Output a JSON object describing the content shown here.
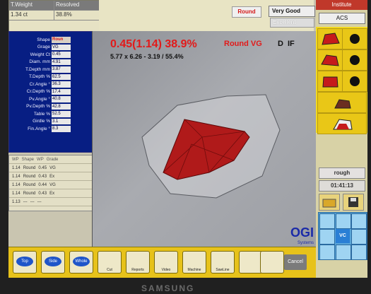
{
  "top_table": {
    "headers": [
      "T.Weight",
      "Resolved"
    ],
    "values": [
      "1.34 ct",
      "38.8%"
    ]
  },
  "params": [
    {
      "label": "Shape",
      "value": "Roun",
      "red": true
    },
    {
      "label": "Grage",
      "value": "VG"
    },
    {
      "label": "Weight  Ct",
      "value": "0.45"
    },
    {
      "label": "Diam.  mm",
      "value": "4.91"
    },
    {
      "label": "T.Depth  mm",
      "value": "3.87"
    },
    {
      "label": "T.Depth  %",
      "value": "62.5"
    },
    {
      "label": "Cr.Angle  °",
      "value": "36.3"
    },
    {
      "label": "Cr.Depth  %",
      "value": "17.4"
    },
    {
      "label": "Pv.Angle  °",
      "value": "40.8"
    },
    {
      "label": "Pv.Depth  %",
      "value": "42.8"
    },
    {
      "label": "Table  %",
      "value": "52.5"
    },
    {
      "label": "Girdle  %",
      "value": "3.1"
    },
    {
      "label": "Fin.Angle  °",
      "value": "8.3"
    }
  ],
  "history": {
    "headers": [
      "WP",
      "Shape",
      "WP",
      "Grade"
    ],
    "rows": [
      [
        "1.14",
        "Round",
        "0.45",
        "VG"
      ],
      [
        "1.14",
        "Round",
        "0.43",
        "Ex"
      ],
      [
        "1.14",
        "Round",
        "0.44",
        "VG"
      ],
      [
        "1.14",
        "Round",
        "0.43",
        "Ex"
      ],
      [
        "1.13",
        "---",
        "---",
        "---"
      ]
    ]
  },
  "strip": {
    "shape_value": "Round",
    "cut_grade": "Very Good",
    "polish_grade": "Excellent"
  },
  "viewport": {
    "headline": "0.45(1.14) 38.9%",
    "dims": "5.77 x 6.26 - 3.19 / 55.4%",
    "shape_grade": "Round VG",
    "color": "D",
    "clarity": "IF",
    "brand": "OGI",
    "brand_sub": "Systems"
  },
  "right_panel": {
    "top_label": "Institute",
    "acs_label": "ACS",
    "rough_label": "rough",
    "timer": "01:41:13",
    "nav_center": "VC"
  },
  "toolbar": {
    "buttons": [
      "Top",
      "Side",
      "Whole",
      "Cut",
      "Reports",
      "Video",
      "Machine",
      "SawLine",
      "",
      ""
    ],
    "cancel_label": "Cancel"
  },
  "monitor_brand": "SAMSUNG",
  "colors": {
    "accent_red": "#e21a1a",
    "panel_blue": "#071e83",
    "toolbar_yellow": "#e7c21a"
  }
}
